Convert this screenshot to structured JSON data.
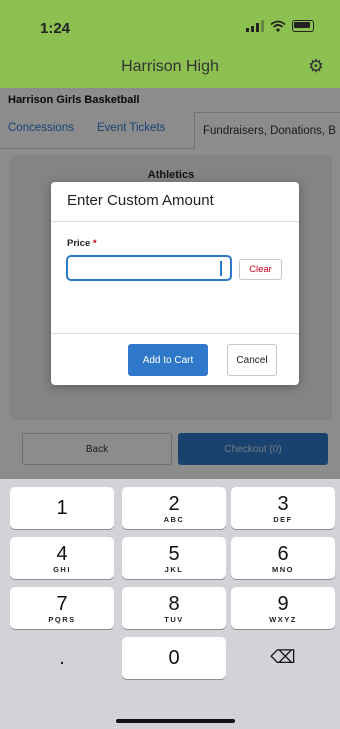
{
  "status_bar": {
    "time": "1:24"
  },
  "header": {
    "title": "Harrison High",
    "settings_icon": "gear-icon"
  },
  "org_title": "Harrison Girls Basketball",
  "tabs": [
    {
      "label": "Concessions"
    },
    {
      "label": "Event Tickets"
    },
    {
      "label": "Fundraisers, Donations, B"
    }
  ],
  "panel": {
    "title": "Athletics"
  },
  "footer": {
    "back_label": "Back",
    "checkout_label": "Checkout (0)"
  },
  "modal": {
    "title": "Enter Custom Amount",
    "price_label": "Price",
    "required_mark": "*",
    "price_value": "",
    "clear_label": "Clear",
    "add_label": "Add to Cart",
    "cancel_label": "Cancel"
  },
  "keypad": {
    "keys": [
      {
        "num": "1",
        "letters": ""
      },
      {
        "num": "2",
        "letters": "ABC"
      },
      {
        "num": "3",
        "letters": "DEF"
      },
      {
        "num": "4",
        "letters": "GHI"
      },
      {
        "num": "5",
        "letters": "JKL"
      },
      {
        "num": "6",
        "letters": "MNO"
      },
      {
        "num": "7",
        "letters": "PQRS"
      },
      {
        "num": "8",
        "letters": "TUV"
      },
      {
        "num": "9",
        "letters": "WXYZ"
      },
      {
        "num": ".",
        "letters": ""
      },
      {
        "num": "0",
        "letters": ""
      }
    ],
    "delete_icon": "⌫"
  }
}
